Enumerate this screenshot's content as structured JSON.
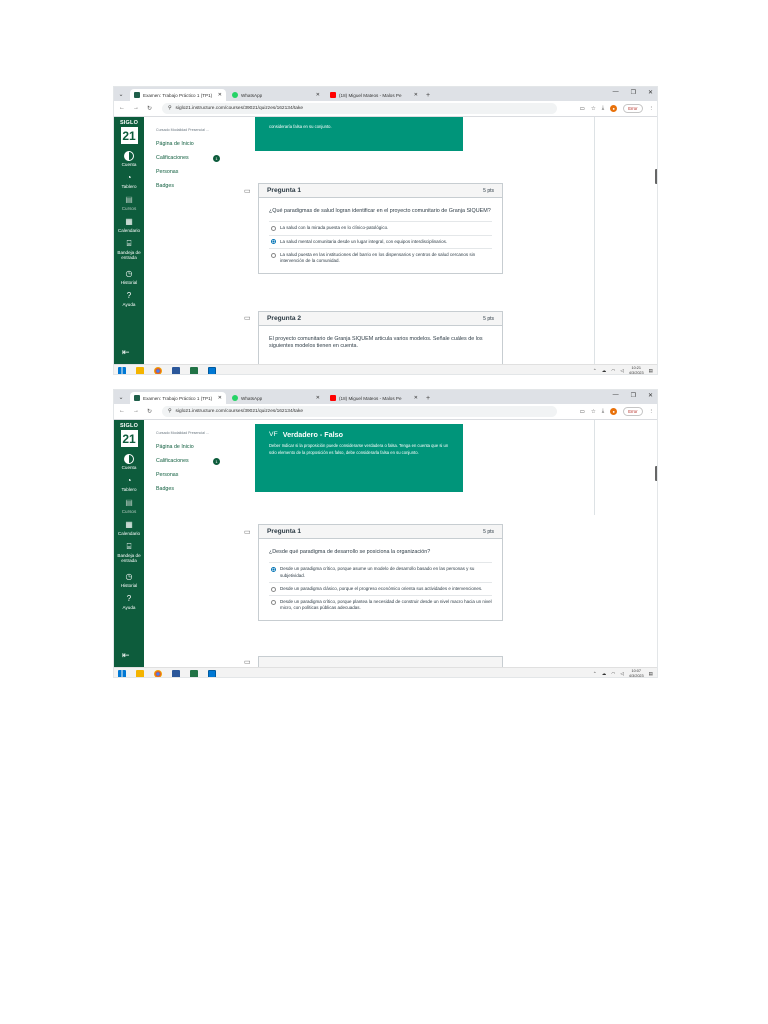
{
  "browser": {
    "tabs": [
      {
        "title": "Examen: Trabajo Práctico 1 (TP1)",
        "active": true,
        "color": "#1f5f4a"
      },
      {
        "title": "WhatsApp",
        "active": false,
        "color": "#25d366"
      },
      {
        "title": "(18) Miguel Mateos - Malos Pe",
        "active": false,
        "color": "#ff0000"
      }
    ],
    "url": "siglo21.instructure.com/courses/39021/quizzes/162134/take",
    "error_label": "Error"
  },
  "gnav": {
    "logo_top": "SIGLO",
    "logo_num": "21",
    "items": [
      "Cuenta",
      "Tablero",
      "Cursos",
      "Calendario",
      "Bandeja de entrada",
      "Historial",
      "Ayuda"
    ]
  },
  "coursenav": {
    "course_title": "Cursado Modalidad Presencial ...",
    "links": [
      "Página de Inicio",
      "Calificaciones",
      "Personas",
      "Badges"
    ],
    "badge_count": "1"
  },
  "shot1": {
    "top_text": "consideraría falsa en su conjunto.",
    "q1": {
      "title": "Pregunta 1",
      "points": "5 pts",
      "text": "¿Qué paradigmas de salud logran identificar en el proyecto comunitario de Granja SIQUEM?",
      "options": [
        {
          "text": "La salud con la mirada puesta en lo clínico-patológico.",
          "selected": false
        },
        {
          "text": "La salud mental comunitaria desde un lugar integral, con equipos interdisciplinarios.",
          "selected": true
        },
        {
          "text": "La salud puesta en las instituciones del barrio en los dispensarios y centros de salud cercanos sin intervención de la comunidad.",
          "selected": false
        }
      ]
    },
    "q2": {
      "title": "Pregunta 2",
      "points": "5 pts",
      "text": "El proyecto comunitario de Granja SIQUEM articula varios modelos. Señale cuáles de los siguientes modelos tienen en cuenta."
    },
    "time": "10:21",
    "date": "4/3/2023"
  },
  "shot2": {
    "vf_tag": "VF",
    "vf_title": "Verdadero - Falso",
    "vf_text": "Deber Indicar si la proposición puede considerarse verdadera o falsa. Tenga en cuenta que si un solo elemento de la proposición es falso, debe considerarla falsa en su conjunto.",
    "q1": {
      "title": "Pregunta 1",
      "points": "5 pts",
      "text": "¿Desde qué paradigma de desarrollo se posiciona la organización?",
      "options": [
        {
          "text": "Desde un paradigma crítico, porque asume un modelo de desarrollo basado en las personas y su subjetividad.",
          "selected": true
        },
        {
          "text": "Desde un paradigma clásico, porque el progreso económico orienta sus actividades e intervenciones.",
          "selected": false
        },
        {
          "text": "Desde un paradigma crítico, porque plantea la necesidad de construir desde un nivel macro hacia un nivel micro, con políticas públicas adecuadas.",
          "selected": false
        }
      ]
    },
    "time": "10:07",
    "date": "4/3/2023"
  },
  "colors": {
    "canvas_green": "#0d5c3c",
    "teal": "#00957a",
    "link_blue": "#0374b5"
  }
}
